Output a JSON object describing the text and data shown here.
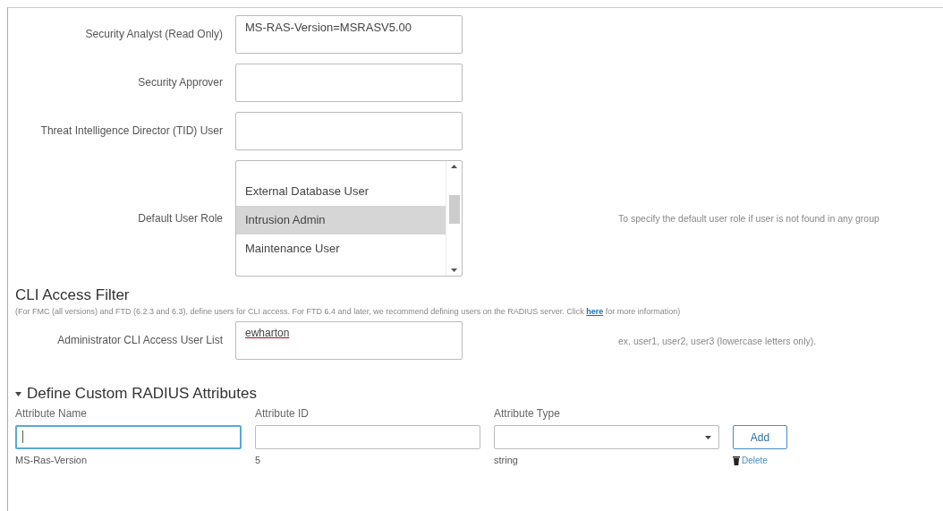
{
  "role_fields": [
    {
      "label": "Security Analyst (Read Only)",
      "value": "MS-RAS-Version=MSRASV5.00"
    },
    {
      "label": "Security Approver"
    },
    {
      "label": "Threat Intelligence Director (TID) User"
    }
  ],
  "default_role": {
    "label": "Default User Role",
    "options": [
      {
        "label": "External Database User",
        "selected": false
      },
      {
        "label": "Intrusion Admin",
        "selected": true
      },
      {
        "label": "Maintenance User",
        "selected": false
      }
    ],
    "hint": "To specify the default user role if user is not found in any group"
  },
  "cli_filter": {
    "title": "CLI Access Filter",
    "description_before": "(For FMC (all versions) and FTD (6.2.3 and 6.3), define users for CLI access. For FTD 6.4 and later, we recommend defining users on the RADIUS server. Click",
    "link": "here",
    "description_after": "for more information)",
    "field_label": "Administrator CLI Access User List",
    "value": "ewharton",
    "hint": "ex. user1, user2, user3 (lowercase letters only)."
  },
  "custom_attributes": {
    "title": "Define Custom RADIUS Attributes",
    "expanded": true,
    "columns": [
      "Attribute Name",
      "Attribute ID",
      "Attribute Type"
    ],
    "name_focused": true,
    "add_button": "Add",
    "rows": [
      {
        "name": "MS-Ras-Version",
        "id": "5",
        "type": "string",
        "action": "Delete"
      }
    ]
  }
}
